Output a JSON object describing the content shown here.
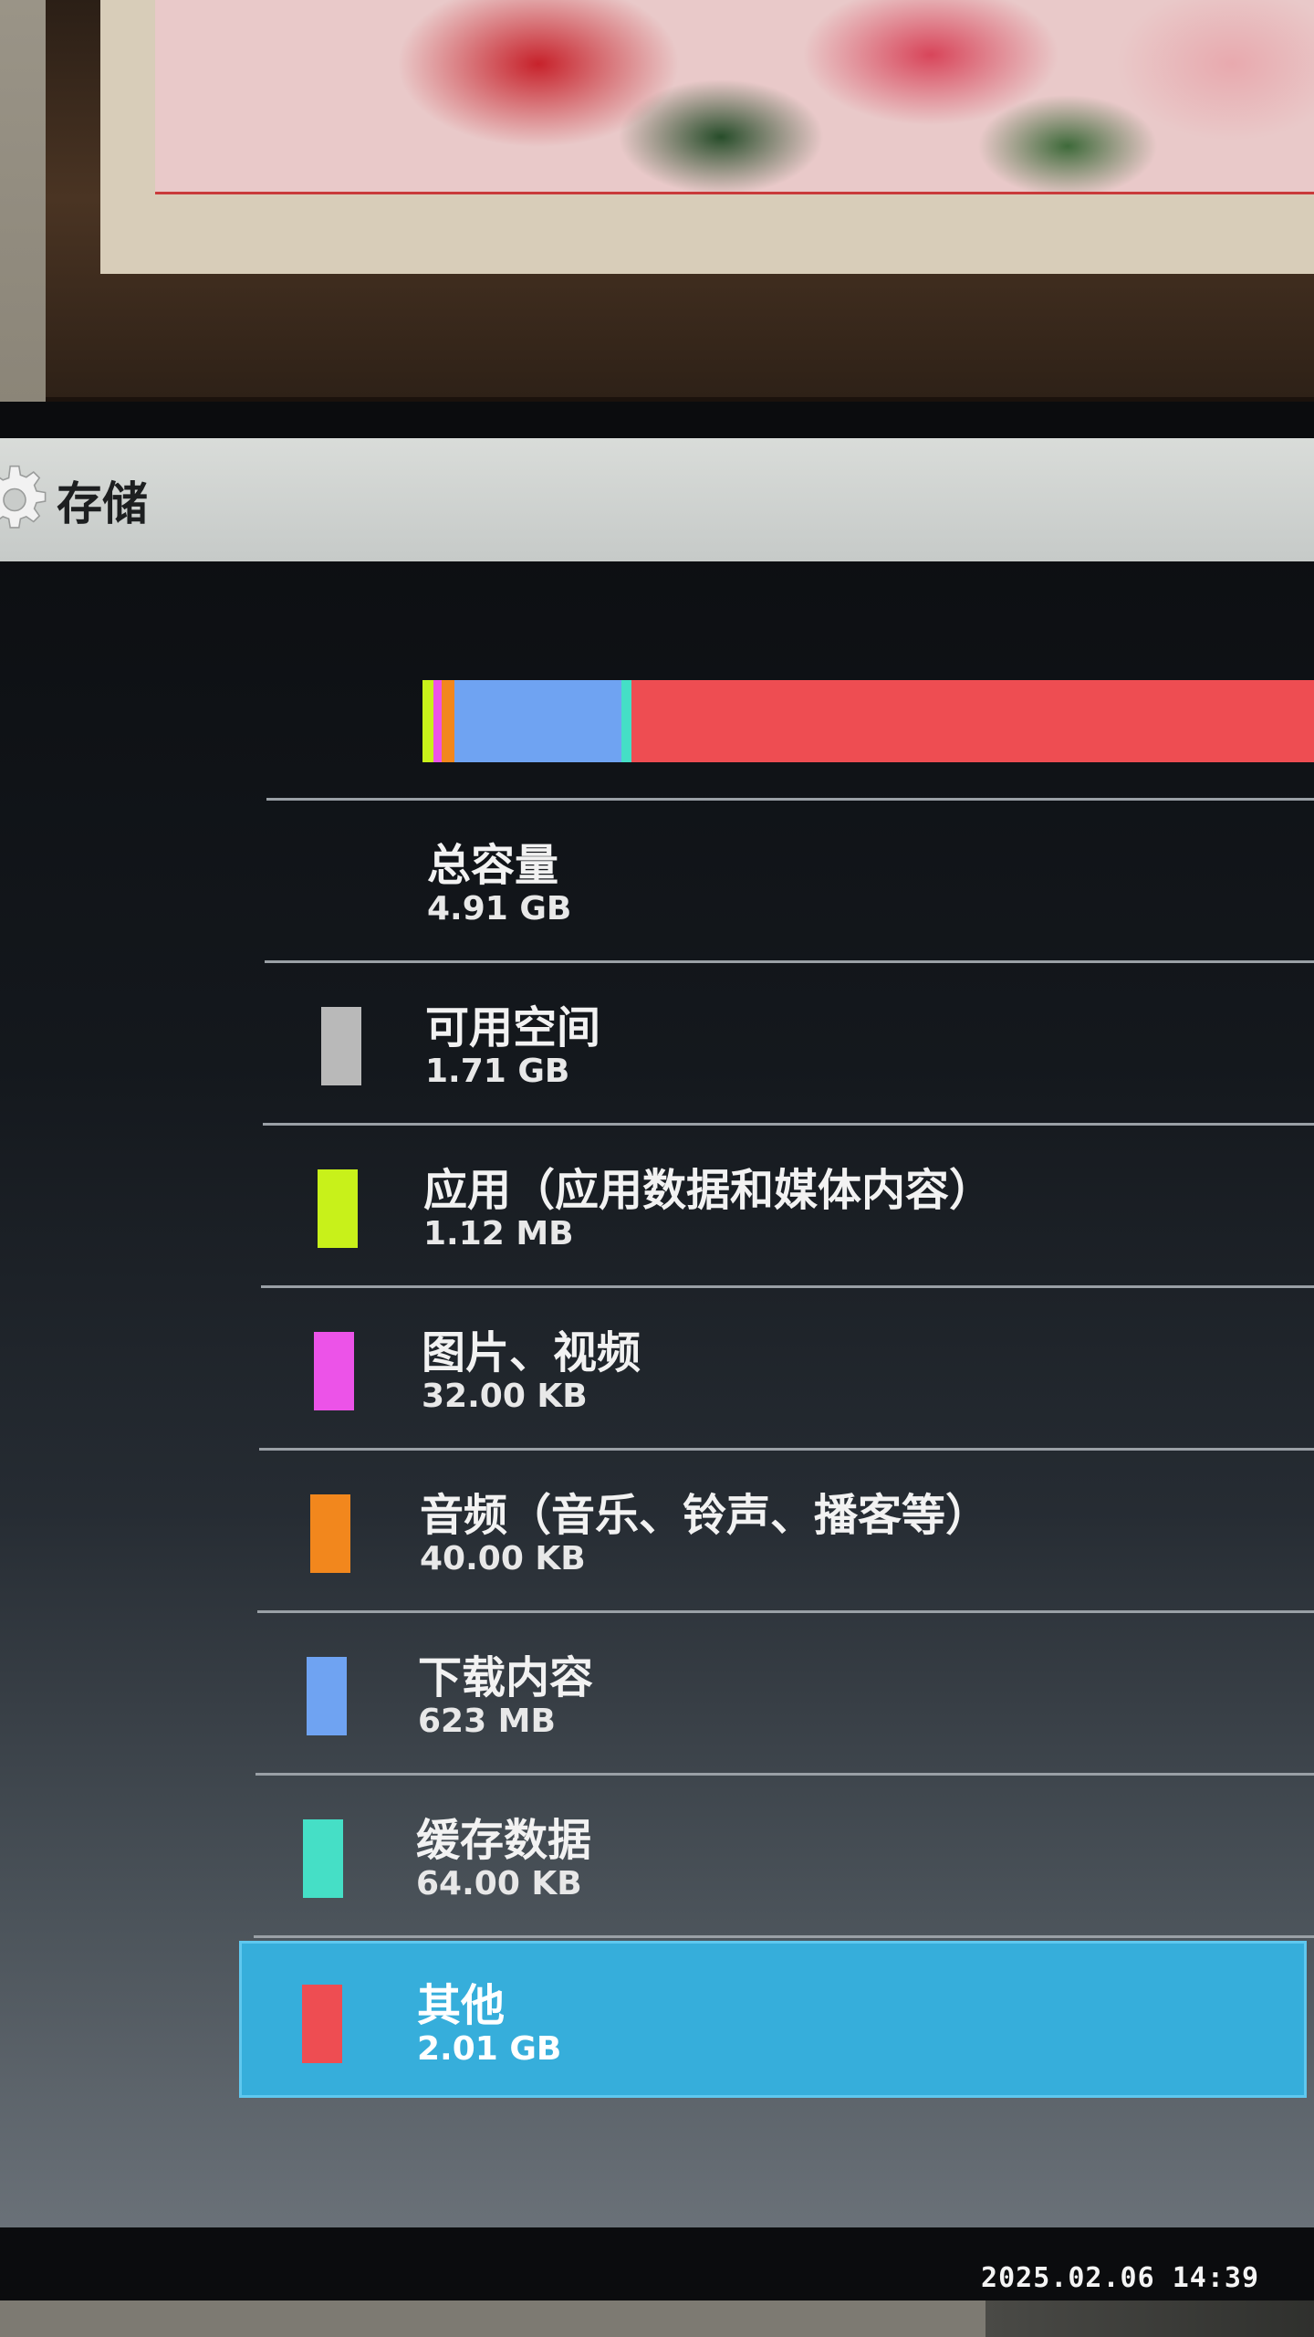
{
  "window": {
    "title": "存储"
  },
  "storage": {
    "segments": [
      {
        "name": "apps",
        "color": "#c8f11a",
        "fraction": 0.012
      },
      {
        "name": "pictures",
        "color": "#ec53e8",
        "fraction": 0.01
      },
      {
        "name": "audio",
        "color": "#f2871d",
        "fraction": 0.014
      },
      {
        "name": "downloads",
        "color": "#6fa3f2",
        "fraction": 0.187
      },
      {
        "name": "cache",
        "color": "#45dfc6",
        "fraction": 0.011
      },
      {
        "name": "other",
        "color": "#ee4d52",
        "fraction": 0.766
      }
    ],
    "items": [
      {
        "key": "total",
        "title": "总容量",
        "value": "4.91 GB"
      },
      {
        "key": "available",
        "title": "可用空间",
        "value": "1.71 GB",
        "color": "#b9b9b9"
      },
      {
        "key": "apps",
        "title": "应用（应用数据和媒体内容）",
        "value": "1.12 MB",
        "color": "#c8f11a"
      },
      {
        "key": "pictures",
        "title": "图片、视频",
        "value": "32.00 KB",
        "color": "#ec53e8"
      },
      {
        "key": "audio",
        "title": "音频（音乐、铃声、播客等）",
        "value": "40.00 KB",
        "color": "#f2871d"
      },
      {
        "key": "downloads",
        "title": "下载内容",
        "value": "623 MB",
        "color": "#6fa3f2"
      },
      {
        "key": "cache",
        "title": "缓存数据",
        "value": "64.00 KB",
        "color": "#45dfc6"
      },
      {
        "key": "other",
        "title": "其他",
        "value": "2.01 GB",
        "color": "#ee4d52",
        "selected": true
      }
    ]
  },
  "photo": {
    "timestamp": "2025.02.06 14:39"
  }
}
